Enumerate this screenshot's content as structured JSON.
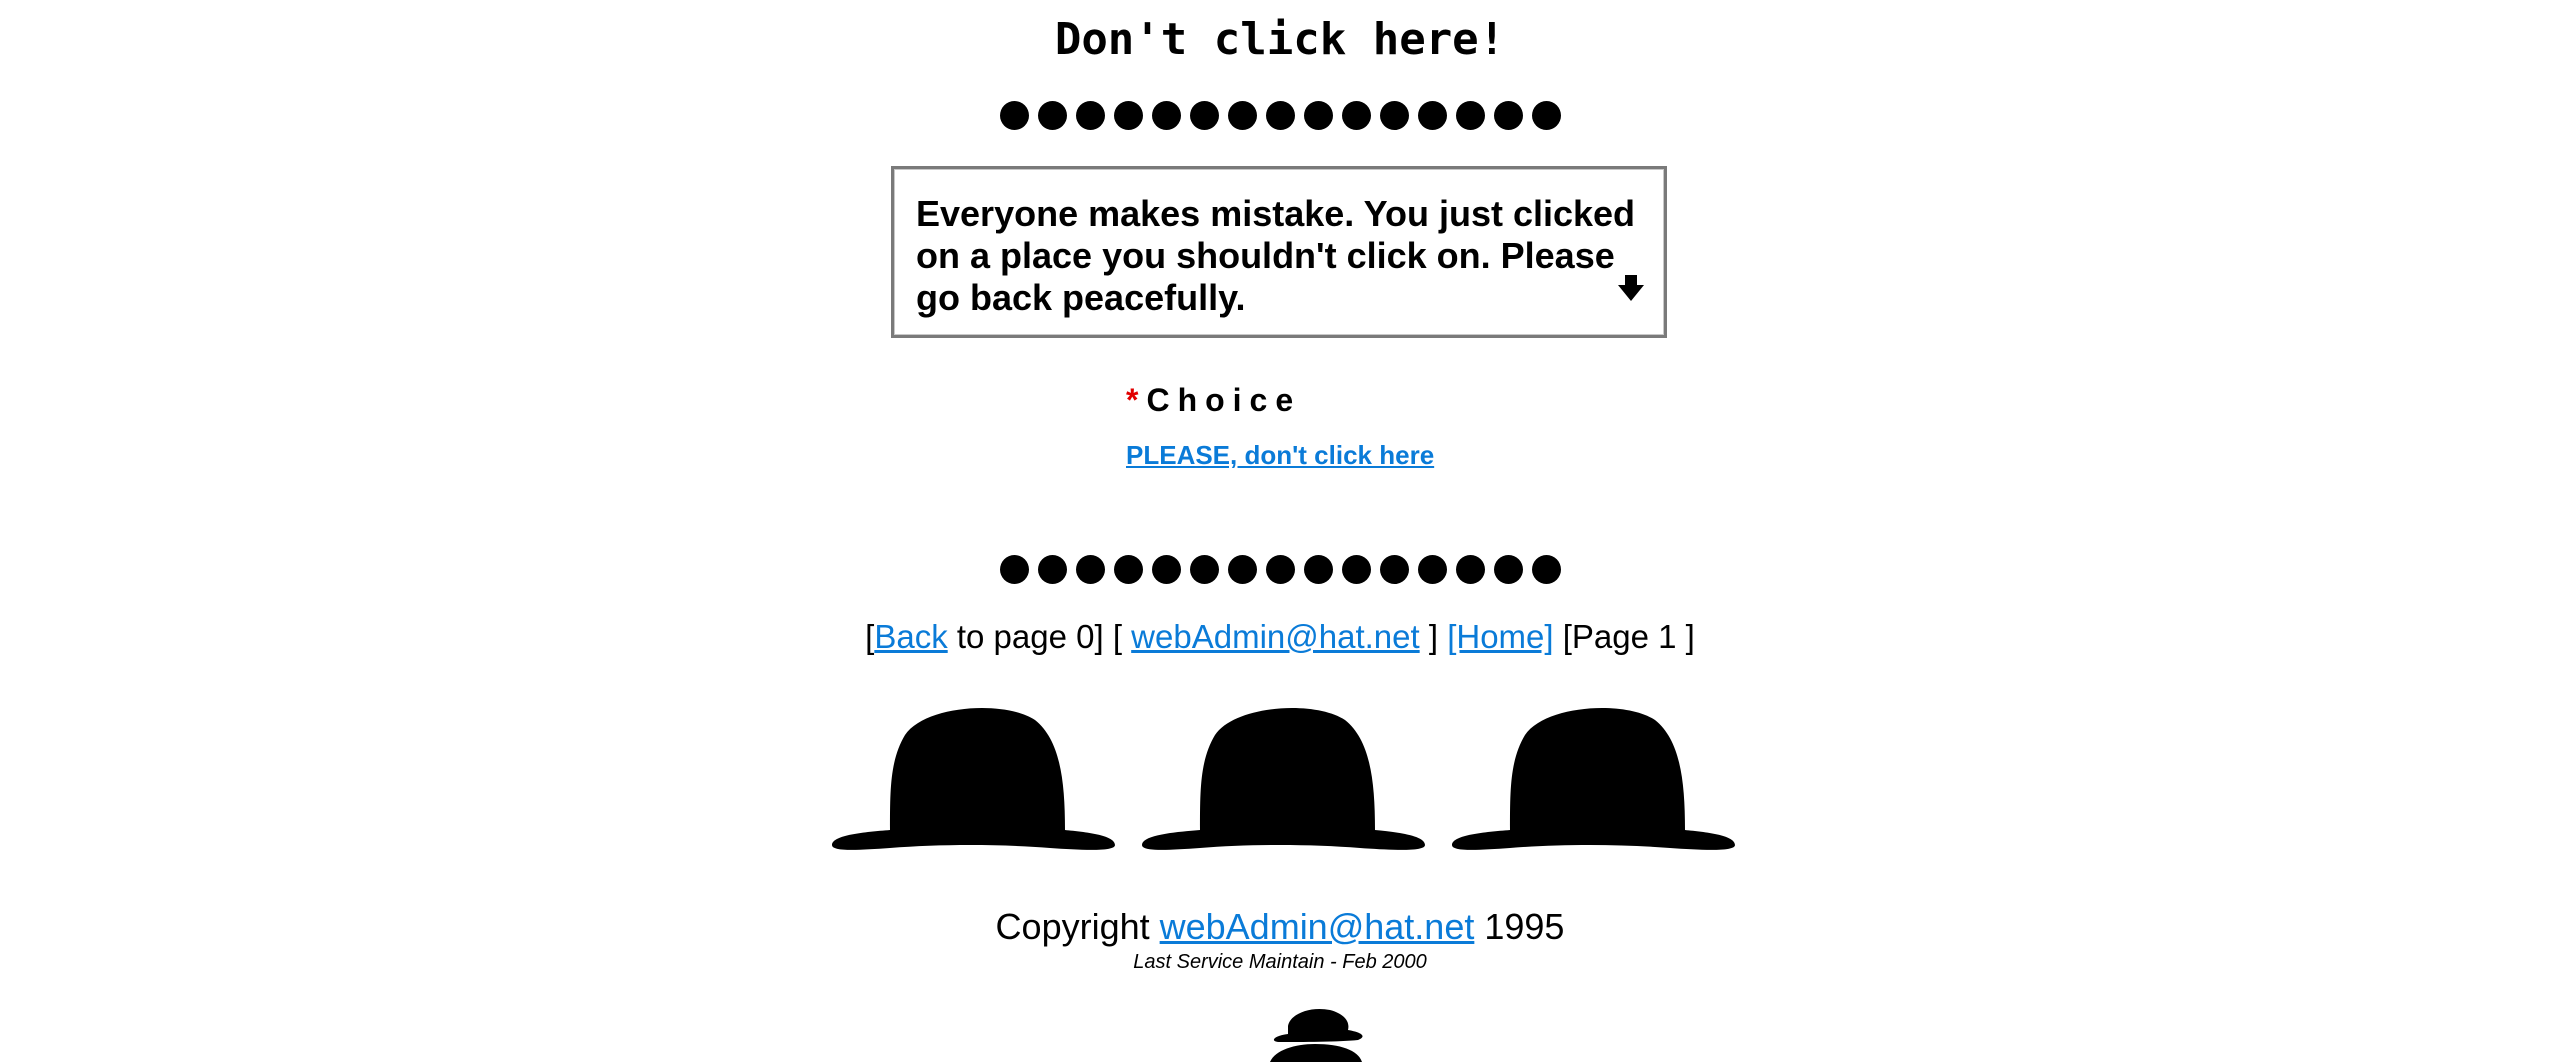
{
  "page": {
    "title": "Don't click here!"
  },
  "decor": {
    "dot_count": 15,
    "dot_icon": "black-dot-icon"
  },
  "notice": {
    "text": "Everyone makes mistake. You just clicked on a place you shouldn't click on. Please go back peacefully.",
    "scroll_icon": "arrow-down-icon"
  },
  "choice": {
    "required_mark": "*",
    "label": "Choice",
    "link_text": "PLEASE, don't click here"
  },
  "nav": {
    "open_bracket_1": "[",
    "back_link": "Back",
    "back_suffix": " to page 0] [ ",
    "email_link": "webAdmin@hat.net",
    "sep_2": " ] ",
    "home_link": "[Home]",
    "page_label": " [Page 1 ]"
  },
  "hats": {
    "count": 3,
    "icon": "bowler-hat-icon"
  },
  "footer": {
    "copyright_prefix": "Copyright ",
    "copyright_email": "webAdmin@hat.net",
    "copyright_year": " 1995",
    "maintain": "Last Service Maintain - Feb 2000"
  },
  "colors": {
    "link": "#0a7bd8",
    "required": "#e10000",
    "box_border": "#7a7a7a"
  }
}
